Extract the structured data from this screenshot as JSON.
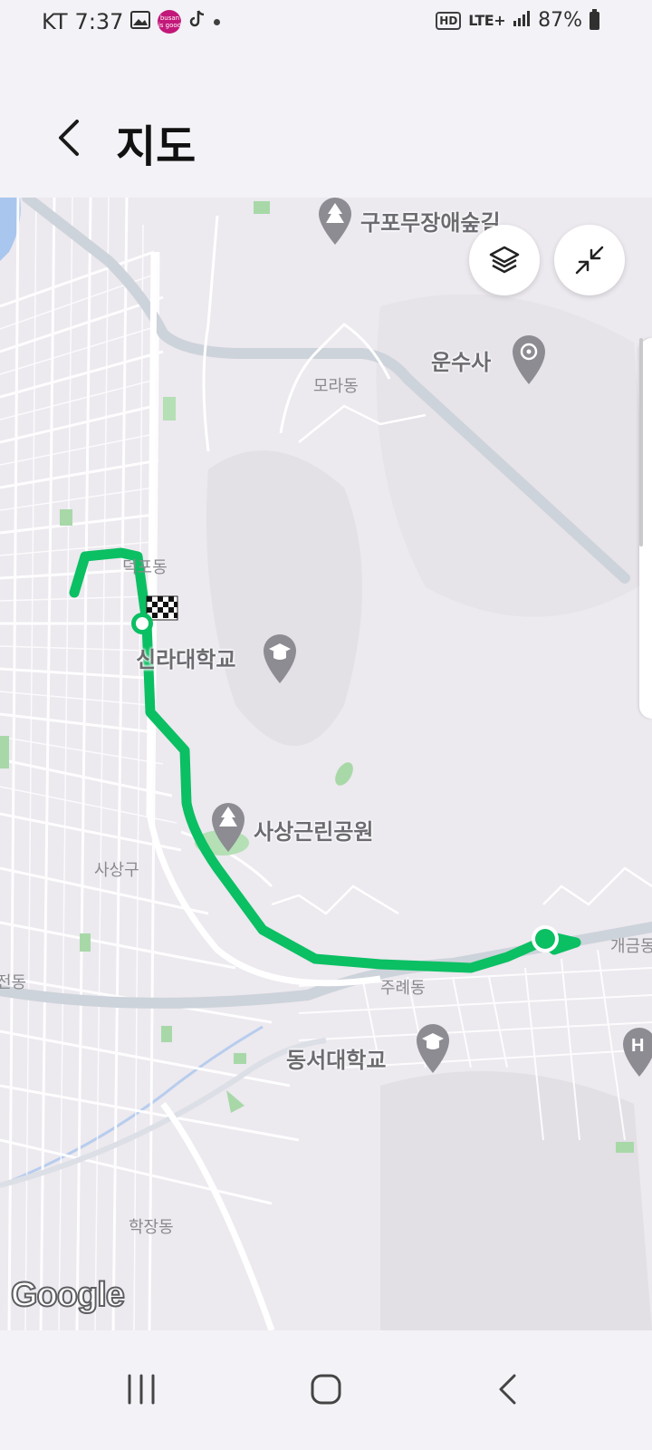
{
  "status_bar": {
    "carrier": "KT",
    "time": "7:37",
    "badge_text": "busan is good",
    "hd": "HD",
    "network": "LTE+",
    "battery": "87%"
  },
  "header": {
    "title": "지도"
  },
  "map": {
    "place_labels": {
      "gupo_forest": "구포무장애숲길",
      "unsusa": "운수사",
      "mora_dong": "모라동",
      "deokpo_dong": "덕포동",
      "silla_univ": "신라대학교",
      "sasang_park": "사상근린공원",
      "sasang_gu": "사상구",
      "jurye_dong": "주례동",
      "gaegeum": "개금동",
      "dongseo_univ": "동서대학교",
      "hakjang_dong": "학장동",
      "jeon_dong": "전동"
    },
    "attribution": "Google",
    "route_color": "#0bbf63"
  },
  "icons": {
    "back": "chevron-left-icon",
    "layers": "layers-icon",
    "collapse": "collapse-icon",
    "finish": "checkered-flag-icon",
    "start": "start-marker-icon"
  }
}
